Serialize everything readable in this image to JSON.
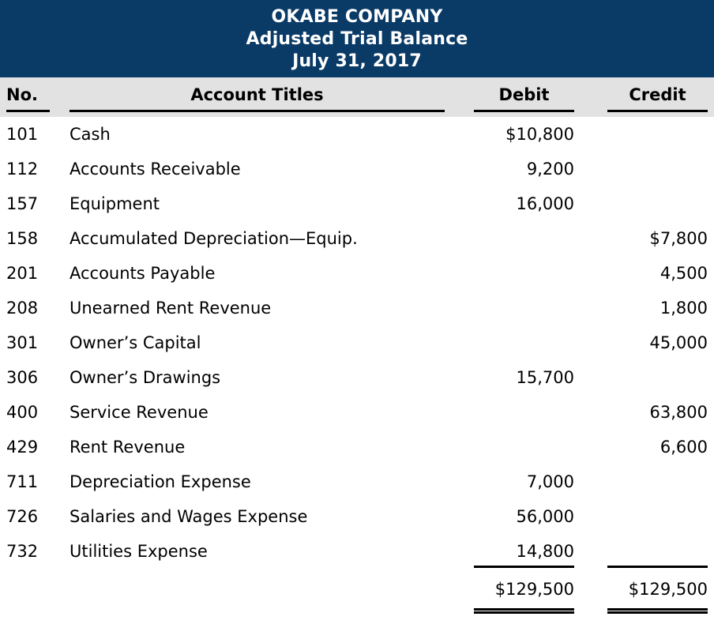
{
  "document": {
    "company": "OKABE COMPANY",
    "statement_title": "Adjusted Trial Balance",
    "statement_date": "July 31, 2017"
  },
  "colors": {
    "banner_background": "#0a3a66",
    "banner_text": "#ffffff",
    "header_band_background": "#e2e2e2",
    "rule": "#000000",
    "body_text": "#000000",
    "page_background": "#ffffff"
  },
  "columns": {
    "no": "No.",
    "account_titles": "Account Titles",
    "debit": "Debit",
    "credit": "Credit"
  },
  "rows": [
    {
      "no": "101",
      "title": "Cash",
      "debit": "$10,800",
      "credit": ""
    },
    {
      "no": "112",
      "title": "Accounts Receivable",
      "debit": "9,200",
      "credit": ""
    },
    {
      "no": "157",
      "title": "Equipment",
      "debit": "16,000",
      "credit": ""
    },
    {
      "no": "158",
      "title": "Accumulated Depreciation—Equip.",
      "debit": "",
      "credit": "$7,800"
    },
    {
      "no": "201",
      "title": "Accounts Payable",
      "debit": "",
      "credit": "4,500"
    },
    {
      "no": "208",
      "title": "Unearned Rent Revenue",
      "debit": "",
      "credit": "1,800"
    },
    {
      "no": "301",
      "title": "Owner’s Capital",
      "debit": "",
      "credit": "45,000"
    },
    {
      "no": "306",
      "title": "Owner’s Drawings",
      "debit": "15,700",
      "credit": ""
    },
    {
      "no": "400",
      "title": "Service Revenue",
      "debit": "",
      "credit": "63,800"
    },
    {
      "no": "429",
      "title": "Rent Revenue",
      "debit": "",
      "credit": "6,600"
    },
    {
      "no": "711",
      "title": "Depreciation Expense",
      "debit": "7,000",
      "credit": ""
    },
    {
      "no": "726",
      "title": "Salaries and Wages Expense",
      "debit": "56,000",
      "credit": ""
    },
    {
      "no": "732",
      "title": "Utilities Expense",
      "debit": "14,800",
      "credit": ""
    }
  ],
  "totals": {
    "debit": "$129,500",
    "credit": "$129,500"
  }
}
